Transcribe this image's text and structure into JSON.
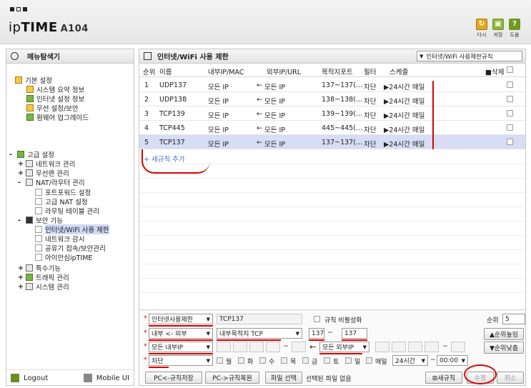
{
  "header": {
    "brand_light": "ip",
    "brand_bold": "TIME",
    "model": "A104",
    "buttons": [
      {
        "label": "다시",
        "color": "#d9a21b",
        "glyph": "↻"
      },
      {
        "label": "저장",
        "color": "#8ab833",
        "glyph": "▣"
      },
      {
        "label": "도움",
        "color": "#7ea82a",
        "glyph": "?"
      }
    ]
  },
  "sidebar": {
    "title": "메뉴탐색기",
    "basic": {
      "label": "기본 설정",
      "items": [
        "시스템 요약 정보",
        "인터넷 설정 정보",
        "무선 설정/보안",
        "펌웨어 업그레이드"
      ]
    },
    "advanced": {
      "label": "고급 설정",
      "items": [
        {
          "pm": "+",
          "label": "네트워크 관리"
        },
        {
          "pm": "+",
          "label": "무선랜 관리"
        },
        {
          "pm": "-",
          "label": "NAT/라우터 관리"
        }
      ],
      "nat_items": [
        "포트포워드 설정",
        "고급 NAT 설정",
        "라우팅 테이블 관리"
      ],
      "security": {
        "label": "보안 기능",
        "items": [
          "인터넷/WiFi 사용 제한",
          "네트워크 감시",
          "공유기 접속/보안관리",
          "아이안심ipTIME"
        ]
      },
      "rest": [
        {
          "pm": "+",
          "label": "특수기능"
        },
        {
          "pm": "+",
          "label": "트래픽 관리"
        },
        {
          "pm": "+",
          "label": "시스템 관리"
        }
      ]
    },
    "footer": {
      "logout": "Logout",
      "mobile": "Mobile UI"
    }
  },
  "main": {
    "title": "인터넷/WiFi 사용 제한",
    "rule_type_select": "인터넷/WiFi 사용제한규칙",
    "columns": {
      "order": "순위",
      "name": "이름",
      "internal": "내부IP/MAC",
      "external": "외부IP/URL",
      "port": "목적지포트",
      "filter": "필터",
      "schedule": "스케줄",
      "delete": "삭제"
    },
    "rows": [
      {
        "order": "1",
        "name": "UDP137",
        "internal": "모든 IP",
        "arrow": "←",
        "external": "모든 IP",
        "port": "137~137(...",
        "filter": "차단",
        "schedule": "▶24시간 매일"
      },
      {
        "order": "2",
        "name": "UDP138",
        "internal": "모든 IP",
        "arrow": "←",
        "external": "모든 IP",
        "port": "138~138(...",
        "filter": "차단",
        "schedule": "▶24시간 매일"
      },
      {
        "order": "3",
        "name": "TCP139",
        "internal": "모든 IP",
        "arrow": "←",
        "external": "모든 IP",
        "port": "139~139(...",
        "filter": "차단",
        "schedule": "▶24시간 매일"
      },
      {
        "order": "4",
        "name": "TCP445",
        "internal": "모든 IP",
        "arrow": "←",
        "external": "모든 IP",
        "port": "445~445(...",
        "filter": "차단",
        "schedule": "▶24시간 매일"
      },
      {
        "order": "5",
        "name": "TCP137",
        "internal": "모든 IP",
        "arrow": "←",
        "external": "모든 IP",
        "port": "137~137(...",
        "filter": "차단",
        "schedule": "▶24시간 매일"
      }
    ],
    "add_rule": "+ 새규칙 추가"
  },
  "form": {
    "rule_kind": "인터넷사용제한",
    "rule_name": "TCP137",
    "disable_label": "규칙 비활성화",
    "priority_label": "순위",
    "priority_value": "5",
    "direction": "내부 <- 외부",
    "port_kind": "내부목적지 TCP",
    "port_from": "137",
    "port_to": "137",
    "port_sep": "~",
    "move_up": "▲순위높임",
    "move_down": "▼순위낮춤",
    "internal_ip": "모든 내부IP",
    "ip_sep": "~",
    "arrow": "←",
    "external_ip": "모든 외부IP",
    "action": "차단",
    "days": [
      "월",
      "화",
      "수",
      "목",
      "금",
      "토",
      "일"
    ],
    "everyday": "매일",
    "time_range": "24시간",
    "time_start": "00:00",
    "buttons": {
      "pc_save": "PC<-규칙저장",
      "pc_restore": "PC->규칙복원",
      "file_select": "파일 선택",
      "no_file": "선택된 파일 없음",
      "new_rule": "⊞새규칙",
      "modify": "수정",
      "cancel": "취소"
    }
  },
  "colors": {
    "accent_annotation": "#d00000",
    "selected_row": "#d6ddf4",
    "link": "#4a6fd0"
  }
}
